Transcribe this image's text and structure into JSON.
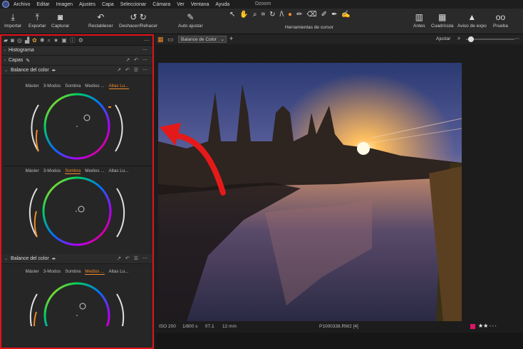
{
  "menubar": {
    "items": [
      "Archivo",
      "Editar",
      "Imagen",
      "Ajustes",
      "Capa",
      "Seleccionar",
      "Cámara",
      "Ver",
      "Ventana",
      "Ayuda"
    ],
    "title": "Dzoom"
  },
  "toolbar": {
    "left": [
      {
        "label": "Importar",
        "icon": "download-icon"
      },
      {
        "label": "Exportar",
        "icon": "upload-icon"
      },
      {
        "label": "Capturar",
        "icon": "camera-icon"
      }
    ],
    "mid": [
      {
        "label": "Restablecer",
        "icon": "reset-icon"
      },
      {
        "label": "Deshacer/Rehacer",
        "icon": "undo-redo-icon"
      },
      {
        "label": "Auto ajustar",
        "icon": "magic-wand-icon"
      }
    ],
    "cursor_tools_label": "Herramientas de cursor",
    "right": [
      {
        "label": "Antes",
        "icon": "before-icon"
      },
      {
        "label": "Cuadrícula",
        "icon": "grid-icon"
      },
      {
        "label": "Aviso de expo",
        "icon": "warning-icon"
      },
      {
        "label": "Prueba",
        "icon": "glasses-icon"
      }
    ]
  },
  "viewer_bar": {
    "mode_select": "Balance de Color",
    "adjust_label": "Ajustar"
  },
  "panel": {
    "sections": {
      "histogram": "Histograma",
      "layers": "Capas",
      "color_balance_1": "Balance del color",
      "color_balance_2": "Balance del color"
    },
    "modes_1": [
      "Máster",
      "3-Modos",
      "Sombra",
      "Medios ...",
      "Altas Lu..."
    ],
    "modes_2": [
      "Máster",
      "3-Modos",
      "Sombra",
      "Medios ...",
      "Altas Lu..."
    ],
    "modes_3": [
      "Máster",
      "3-Modos",
      "Sombra",
      "Medios ...",
      "Altas Lu..."
    ],
    "active_1": 4,
    "active_2": 2,
    "active_3": 3
  },
  "status": {
    "iso": "ISO 200",
    "shutter": "1/800 s",
    "aperture": "f/7.1",
    "focal": "12 mm",
    "filename": "P1000338.RW2 [4]",
    "rating_stars": 2
  },
  "colors": {
    "highlight_border": "#e0141b",
    "accent_orange": "#f08a2c",
    "arrow_red": "#e41a1a"
  }
}
